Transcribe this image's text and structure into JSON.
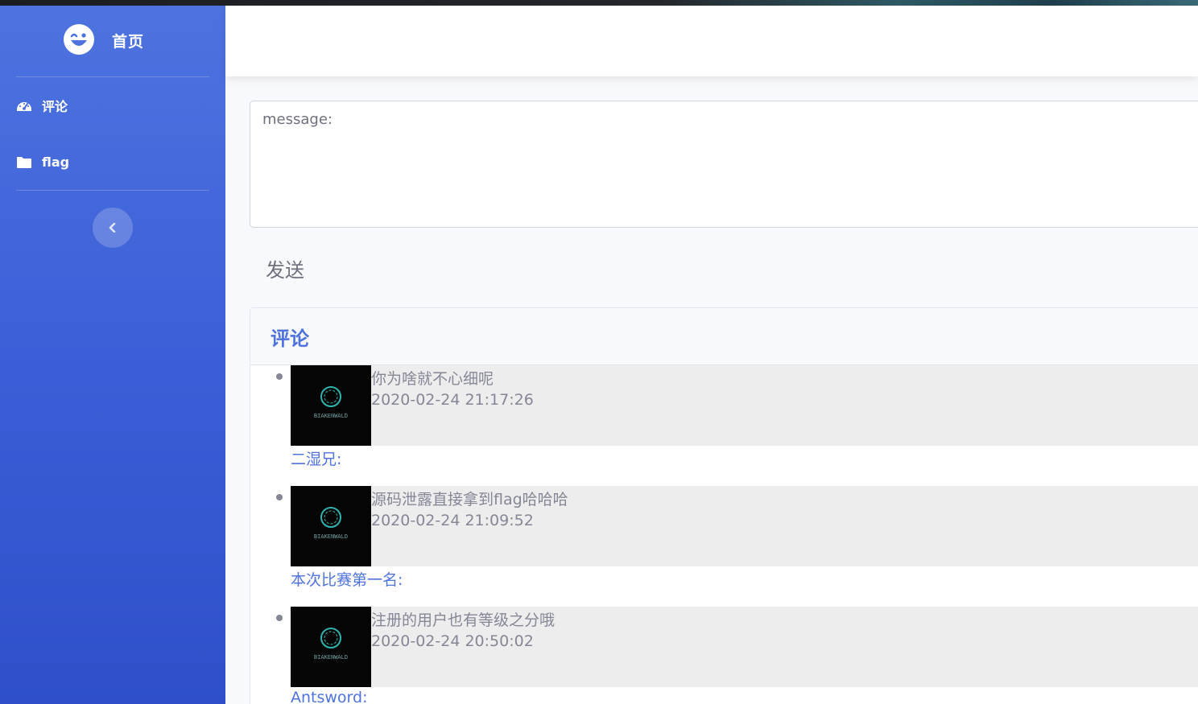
{
  "sidebar": {
    "brand_title": "首页",
    "items": [
      {
        "label": "评论",
        "icon": "tachometer-icon"
      },
      {
        "label": "flag",
        "icon": "folder-icon"
      }
    ],
    "toggle_icon": "chevron-left-icon"
  },
  "form": {
    "message_placeholder": "message:",
    "send_label": "发送"
  },
  "comments_card": {
    "title": "评论",
    "comments": [
      {
        "text": "你为啥就不心细呢",
        "time": "2020-02-24 21:17:26",
        "author": "二湿兄:",
        "avatar_text": "BIAKENWALD"
      },
      {
        "text": "源码泄露直接拿到flag哈哈哈",
        "time": "2020-02-24 21:09:52",
        "author": "本次比赛第一名:",
        "avatar_text": "BIAKENWALD"
      },
      {
        "text": "注册的用户也有等级之分哦",
        "time": "2020-02-24 20:50:02",
        "author": "Antsword:",
        "avatar_text": "BIAKENWALD"
      }
    ]
  },
  "colors": {
    "primary": "#4e73df",
    "sidebar_bottom": "#2e4fc9",
    "text_muted": "#858796",
    "comment_bg": "#ededed"
  }
}
